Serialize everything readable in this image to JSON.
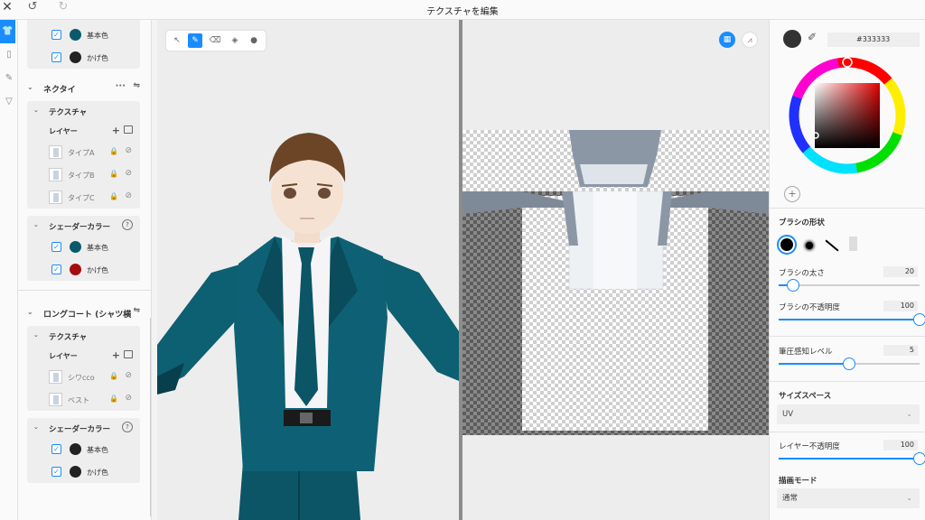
{
  "window": {
    "title": "テクスチャを編集"
  },
  "left_panel": {
    "top_colors": [
      {
        "label": "基本色",
        "color": "#0a5a6c",
        "checked": true
      },
      {
        "label": "かげ色",
        "color": "#222222",
        "checked": true
      }
    ],
    "sections": [
      {
        "label": "ネクタイ",
        "texture_label": "テクスチャ",
        "layer_label": "レイヤー",
        "layers": [
          "タイプA",
          "タイプB",
          "タイプC"
        ],
        "shader_label": "シェーダーカラー",
        "colors": [
          {
            "label": "基本色",
            "color": "#0a5a6c"
          },
          {
            "label": "かげ色",
            "color": "#a50d0d"
          }
        ]
      },
      {
        "label": "ロングコート (シャツ横",
        "texture_label": "テクスチャ",
        "layer_label": "レイヤー",
        "layers": [
          "シワcco",
          "ベスト"
        ],
        "shader_label": "シェーダーカラー",
        "colors": [
          {
            "label": "基本色",
            "color": "#222222"
          },
          {
            "label": "かげ色",
            "color": "#222222"
          }
        ]
      }
    ]
  },
  "right_panel": {
    "hex_value": "#333333",
    "current_color": "#333333",
    "brush_shape_label": "ブラシの形状",
    "brush_size": {
      "label": "ブラシの太さ",
      "value": "20",
      "fraction": 0.1
    },
    "brush_opacity": {
      "label": "ブラシの不透明度",
      "value": "100",
      "fraction": 1.0
    },
    "pressure": {
      "label": "筆圧感知レベル",
      "value": "5",
      "fraction": 0.5
    },
    "size_space": {
      "label": "サイズスペース",
      "value": "UV"
    },
    "layer_opacity": {
      "label": "レイヤー不透明度",
      "value": "100",
      "fraction": 1.0
    },
    "draw_mode": {
      "label": "描画モード",
      "value": "通常"
    }
  },
  "colors": {
    "accent": "#1a8cff",
    "suit": "#0a5a6c"
  }
}
